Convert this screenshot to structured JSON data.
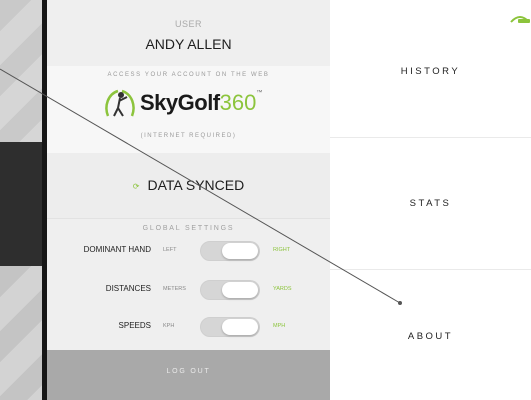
{
  "user": {
    "caption": "USER",
    "name": "ANDY ALLEN"
  },
  "web_access": {
    "caption": "ACCESS YOUR ACCOUNT ON THE WEB",
    "logo_word": "SkyGolf",
    "logo_number": "360",
    "logo_tm": "™",
    "note": "(INTERNET REQUIRED)"
  },
  "sync": {
    "icon": "sync-icon",
    "label": "DATA SYNCED"
  },
  "global_settings": {
    "caption": "GLOBAL SETTINGS",
    "rows": [
      {
        "label": "DOMINANT HAND",
        "left": "LEFT",
        "right": "RIGHT",
        "selected": "right"
      },
      {
        "label": "DISTANCES",
        "left": "METERS",
        "right": "YARDS",
        "selected": "right"
      },
      {
        "label": "SPEEDS",
        "left": "KPH",
        "right": "MPH",
        "selected": "right"
      }
    ]
  },
  "logout": {
    "label": "LOG OUT"
  },
  "nav": {
    "items": [
      {
        "label": "HISTORY"
      },
      {
        "label": "STATS"
      },
      {
        "label": "ABOUT"
      }
    ]
  },
  "colors": {
    "accent": "#8cc43c",
    "dark": "#1e1e1e",
    "panel": "#ececec"
  }
}
